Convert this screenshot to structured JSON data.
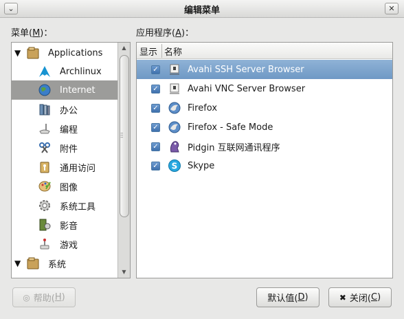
{
  "window": {
    "title": "编辑菜单"
  },
  "menu_label": {
    "text": "菜单(",
    "mnemonic": "M",
    "suffix": ")："
  },
  "apps_label": {
    "text": "应用程序(",
    "mnemonic": "A",
    "suffix": ")："
  },
  "tree": {
    "items": [
      {
        "label": "Applications",
        "expanded": true,
        "level": 0,
        "icon": "folder-icon"
      },
      {
        "label": "Archlinux",
        "level": 1,
        "icon": "arch-logo-icon"
      },
      {
        "label": "Internet",
        "level": 1,
        "icon": "globe-icon",
        "selected": true
      },
      {
        "label": "办公",
        "level": 1,
        "icon": "office-icon"
      },
      {
        "label": "编程",
        "level": 1,
        "icon": "programming-icon"
      },
      {
        "label": "附件",
        "level": 1,
        "icon": "accessories-icon"
      },
      {
        "label": "通用访问",
        "level": 1,
        "icon": "accessibility-icon"
      },
      {
        "label": "图像",
        "level": 1,
        "icon": "graphics-icon"
      },
      {
        "label": "系统工具",
        "level": 1,
        "icon": "system-tools-icon"
      },
      {
        "label": "影音",
        "level": 1,
        "icon": "multimedia-icon"
      },
      {
        "label": "游戏",
        "level": 1,
        "icon": "games-icon"
      },
      {
        "label": "系统",
        "expanded": true,
        "level": 0,
        "icon": "folder-icon"
      }
    ]
  },
  "apps_table": {
    "columns": {
      "show": "显示",
      "name": "名称"
    },
    "rows": [
      {
        "name": "Avahi SSH Server Browser",
        "checked": true,
        "selected": true,
        "icon": "network-browser-icon"
      },
      {
        "name": "Avahi VNC Server Browser",
        "checked": true,
        "icon": "network-browser-icon"
      },
      {
        "name": "Firefox",
        "checked": true,
        "icon": "firefox-icon"
      },
      {
        "name": "Firefox - Safe Mode",
        "checked": true,
        "icon": "firefox-icon"
      },
      {
        "name": "Pidgin 互联网通讯程序",
        "checked": true,
        "icon": "pidgin-icon"
      },
      {
        "name": "Skype",
        "checked": true,
        "icon": "skype-icon"
      }
    ]
  },
  "buttons": {
    "help": {
      "text": "帮助(",
      "mnemonic": "H",
      "suffix": ")",
      "disabled": true
    },
    "default": {
      "text": "默认值(",
      "mnemonic": "D",
      "suffix": ")"
    },
    "close": {
      "text": "关闭(",
      "mnemonic": "C",
      "suffix": ")"
    }
  },
  "colors": {
    "selection_blue": "#7aa1ca",
    "tree_selection": "#9c9c9a",
    "checkbox_blue": "#3f71ad"
  }
}
